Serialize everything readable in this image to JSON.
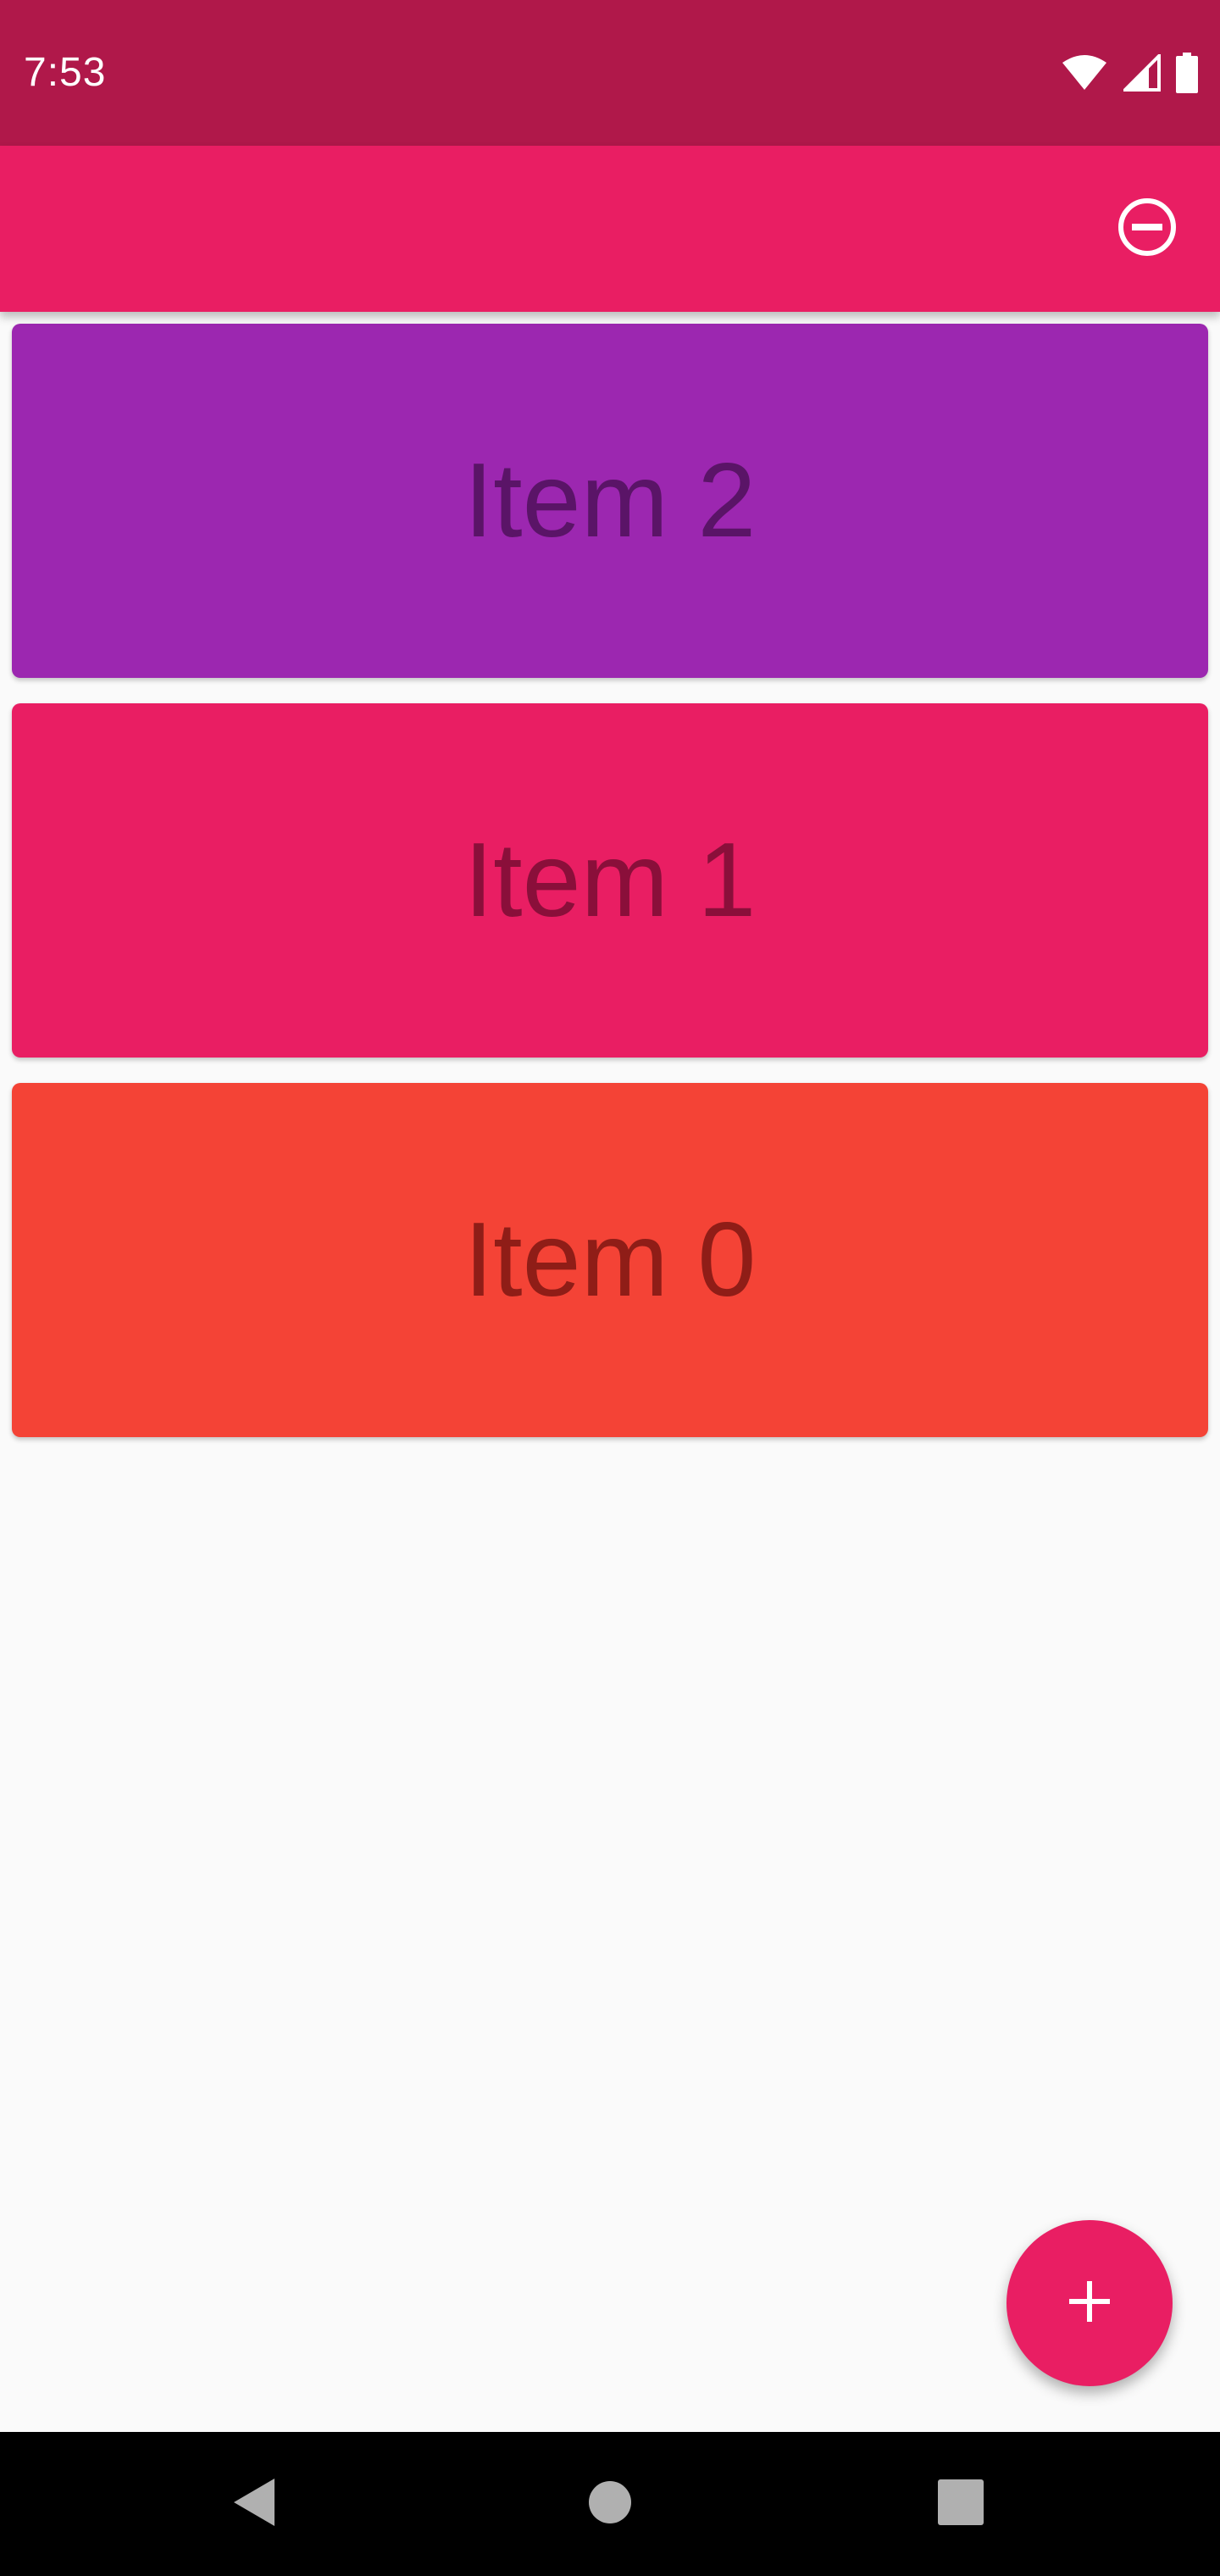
{
  "status_bar": {
    "time": "7:53",
    "background": "#b0184a",
    "icons": [
      "wifi-icon",
      "signal-icon",
      "battery-icon"
    ]
  },
  "app_bar": {
    "background": "#e91e63",
    "action_icon": "remove-circle-outline-icon"
  },
  "cards": [
    {
      "label": "Item 2",
      "color": "#9c27b0",
      "text_color": "#5a1467"
    },
    {
      "label": "Item 1",
      "color": "#e91e63",
      "text_color": "#8a0f3a"
    },
    {
      "label": "Item 0",
      "color": "#f44336",
      "text_color": "#8f1d17"
    }
  ],
  "fab": {
    "icon": "plus-icon",
    "color": "#e91e63"
  },
  "nav_bar": {
    "buttons": [
      "back-icon",
      "home-icon",
      "recents-icon"
    ]
  }
}
